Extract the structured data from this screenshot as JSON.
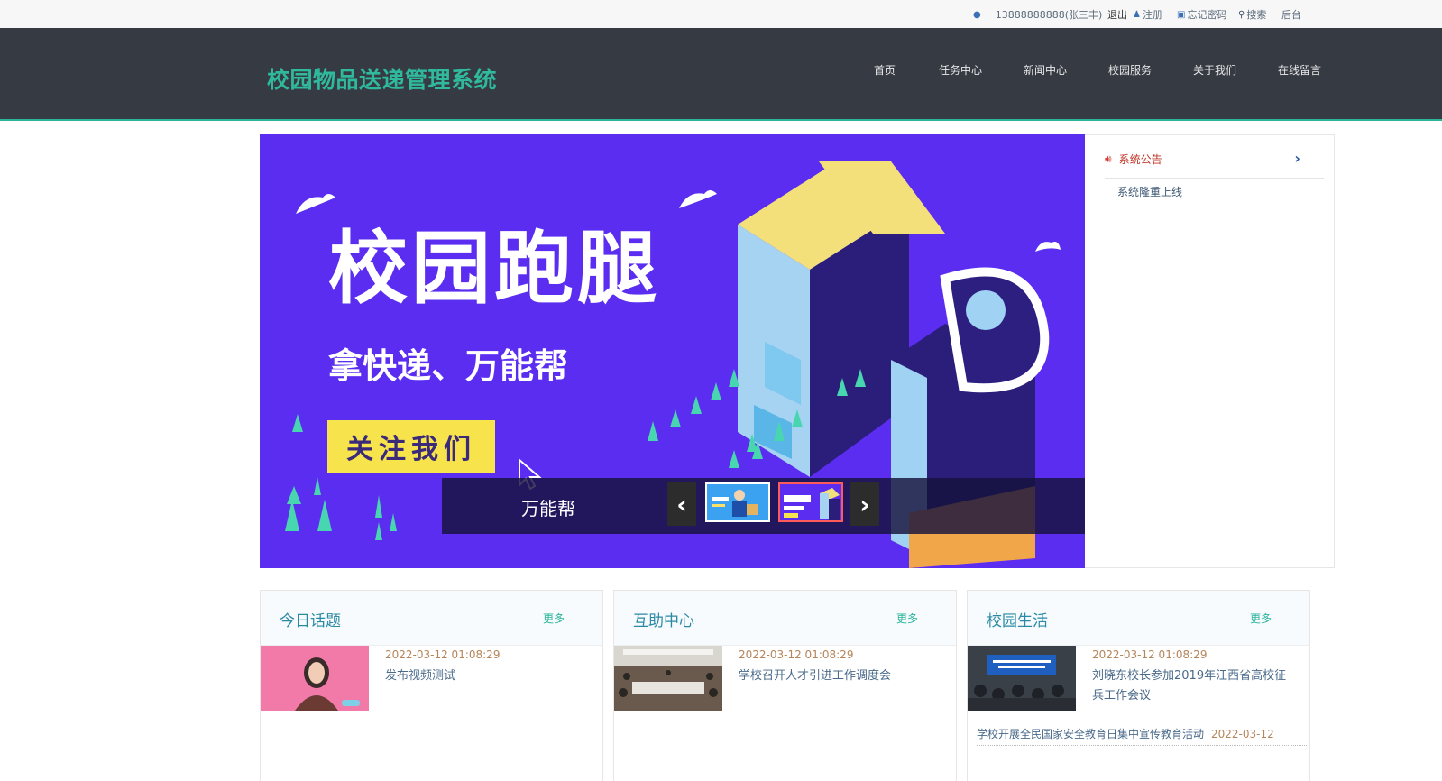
{
  "topbar": {
    "user": "13888888888(张三丰)",
    "logout": "退出",
    "register": "注册",
    "forgot": "忘记密码",
    "search": "搜索",
    "admin": "后台"
  },
  "header": {
    "logo": "校园物品送递管理系统",
    "nav": [
      "首页",
      "任务中心",
      "新闻中心",
      "校园服务",
      "关于我们",
      "在线留言"
    ]
  },
  "banner": {
    "title": "校园跑腿",
    "subtitle": "拿快递、万能帮",
    "cta": "关注我们",
    "caption": "万能帮",
    "prev": "‹",
    "next": "›"
  },
  "notice": {
    "title": "系统公告",
    "items": [
      "系统隆重上线"
    ]
  },
  "cards": [
    {
      "title": "今日话题",
      "more": "更多",
      "date": "2022-03-12 01:08:29",
      "text": "发布视频测试"
    },
    {
      "title": "互助中心",
      "more": "更多",
      "date": "2022-03-12 01:08:29",
      "text": "学校召开人才引进工作调度会"
    },
    {
      "title": "校园生活",
      "more": "更多",
      "date": "2022-03-12 01:08:29",
      "text": "刘晓东校长参加2019年江西省高校征兵工作会议",
      "list_item": "学校开展全民国家安全教育日集中宣传教育活动",
      "list_date": "2022-03-12"
    }
  ],
  "colors": {
    "accent": "#2fb99d",
    "header_bg": "#363b43",
    "banner_bg": "#5a2df0",
    "cta_yellow": "#f7e34b"
  }
}
